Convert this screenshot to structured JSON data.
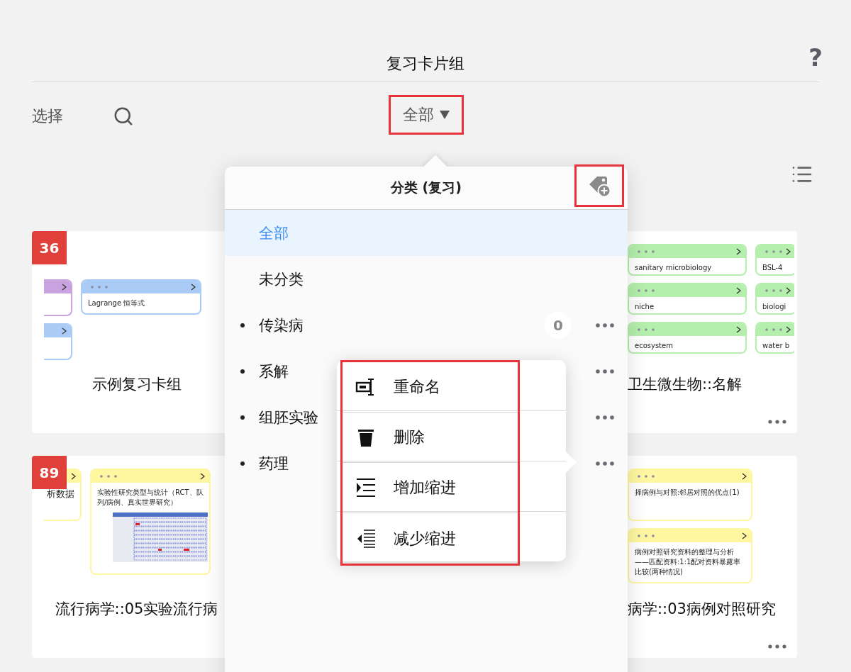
{
  "header": {
    "title": "复习卡片组",
    "help": "?"
  },
  "toolbar": {
    "select": "选择",
    "filter": {
      "label": "全部",
      "highlighted": true
    }
  },
  "cards": [
    {
      "badge": "36",
      "title": "示例复习卡组",
      "more_button": false,
      "columns": [
        [
          {
            "color": "#c9a3e0"
          },
          {
            "color": "#a9cbf5"
          }
        ],
        [
          {
            "color": "#a9cbf5",
            "text": "Lagrange 恒等式"
          }
        ]
      ]
    },
    {
      "title": "卫生微生物::名解",
      "more_button": true,
      "columns": [
        [
          {
            "color": "#b5efad",
            "text": "sanitary microbiology"
          },
          {
            "color": "#b5efad",
            "text": "niche"
          },
          {
            "color": "#b5efad",
            "text": "ecosystem"
          }
        ],
        [
          {
            "color": "#b5efad",
            "text": "BSL-4"
          },
          {
            "color": "#b5efad",
            "text": "biologi"
          },
          {
            "color": "#b5efad",
            "text": "water b"
          }
        ]
      ]
    },
    {
      "badge": "89",
      "title": "流行病学::05实验流行病",
      "more_button": false,
      "columns": [
        [
          {
            "color": "#fff7a0",
            "text": "析数据"
          }
        ],
        [
          {
            "color": "#fff7a0",
            "text": "实验性研究类型与统计（RCT、队列/病例、真实世界研究）",
            "table": true
          }
        ]
      ]
    },
    {
      "title": "病学::03病例对照研究",
      "more_button": true,
      "columns": [
        [
          {
            "color": "#fff7a0",
            "text": "择病例与对照:邻居对照的优点(1)"
          },
          {
            "color": "#fff7a0",
            "text": "病例对照研究资料的整理与分析——匹配资料:1:1配对资料暴露率比较(两种情况)"
          }
        ]
      ]
    }
  ],
  "category_popover": {
    "title": "分类 (复习)",
    "add_highlighted": true,
    "items": [
      {
        "label": "全部",
        "selected": true,
        "bulleted": false,
        "more_button": false
      },
      {
        "label": "未分类",
        "selected": false,
        "bulleted": false,
        "more_button": false
      },
      {
        "label": "传染病",
        "selected": false,
        "bulleted": true,
        "count": "0",
        "more_button": true
      },
      {
        "label": "系解",
        "selected": false,
        "bulleted": true,
        "more_button": true
      },
      {
        "label": "组胚实验",
        "selected": false,
        "bulleted": true,
        "more_button": true
      },
      {
        "label": "药理",
        "selected": false,
        "bulleted": true,
        "more_button": true
      }
    ]
  },
  "context_menu": {
    "highlighted": true,
    "items": [
      {
        "kind": "rename",
        "label": "重命名"
      },
      {
        "kind": "delete",
        "label": "删除"
      },
      {
        "kind": "indent",
        "label": "增加缩进"
      },
      {
        "kind": "outdent",
        "label": "减少缩进"
      }
    ]
  }
}
